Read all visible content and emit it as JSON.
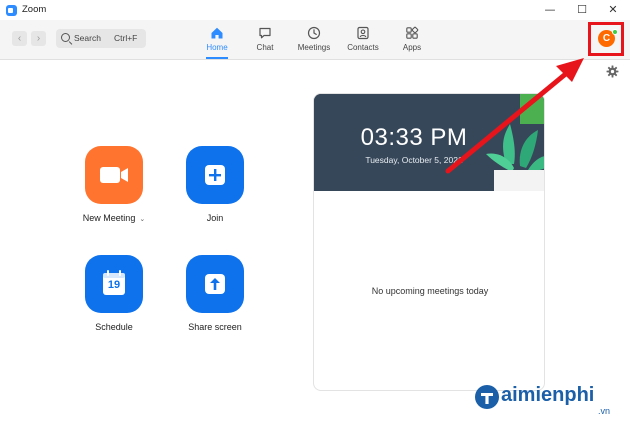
{
  "window": {
    "title": "Zoom"
  },
  "window_controls": {
    "minimize": "—",
    "maximize": "☐",
    "close": "✕"
  },
  "search": {
    "label": "Search",
    "shortcut": "Ctrl+F"
  },
  "tabs": [
    {
      "label": "Home",
      "icon": "home-icon",
      "active": true
    },
    {
      "label": "Chat",
      "icon": "chat-icon",
      "active": false
    },
    {
      "label": "Meetings",
      "icon": "clock-icon",
      "active": false
    },
    {
      "label": "Contacts",
      "icon": "contacts-icon",
      "active": false
    },
    {
      "label": "Apps",
      "icon": "apps-icon",
      "active": false
    }
  ],
  "profile": {
    "initial": "C",
    "status": "online"
  },
  "actions": [
    {
      "label": "New Meeting",
      "icon": "video-camera-icon",
      "color": "#ff742e",
      "has_dropdown": true
    },
    {
      "label": "Join",
      "icon": "plus-icon",
      "color": "#0e72ed",
      "has_dropdown": false
    },
    {
      "label": "Schedule",
      "icon": "calendar-icon",
      "color": "#0e72ed",
      "calendar_day": "19",
      "has_dropdown": false
    },
    {
      "label": "Share screen",
      "icon": "share-up-arrow-icon",
      "color": "#0e72ed",
      "has_dropdown": false
    }
  ],
  "meetings_panel": {
    "time": "03:33 PM",
    "date": "Tuesday, October 5, 2021",
    "empty_message": "No upcoming meetings today"
  },
  "colors": {
    "accent": "#2d8cff",
    "orange": "#ff742e",
    "highlight": "#e8141b"
  },
  "watermark": {
    "brand": "aimienphi",
    "domain": ".vn"
  }
}
